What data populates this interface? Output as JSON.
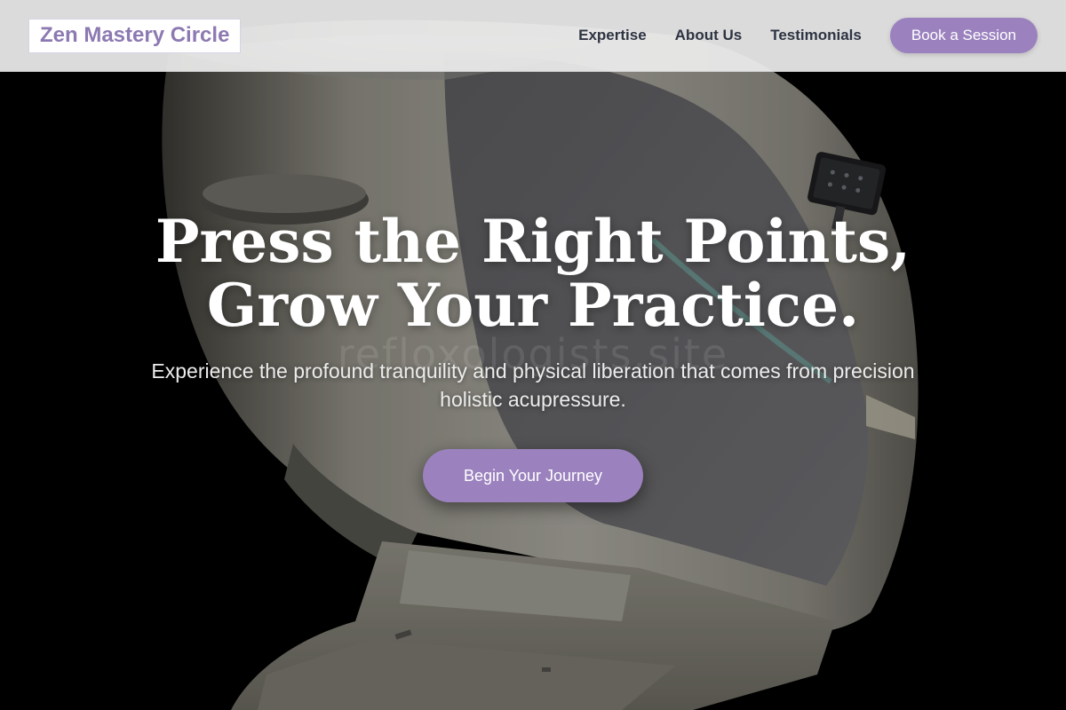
{
  "header": {
    "logo": "Zen Mastery Circle",
    "nav": [
      {
        "label": "Expertise"
      },
      {
        "label": "About Us"
      },
      {
        "label": "Testimonials"
      }
    ],
    "cta": "Book a Session"
  },
  "hero": {
    "headline_line1": "Press the Right Points,",
    "headline_line2": "Grow Your Practice.",
    "subtitle": "Experience the profound tranquility and physical liberation that comes from precision holistic acupressure.",
    "cta": "Begin Your Journey",
    "watermark": "refloxologists.site"
  },
  "colors": {
    "accent": "#9b82bf",
    "logo_text": "#8d79b2",
    "nav_text": "#2d3442",
    "background": "#000000"
  }
}
